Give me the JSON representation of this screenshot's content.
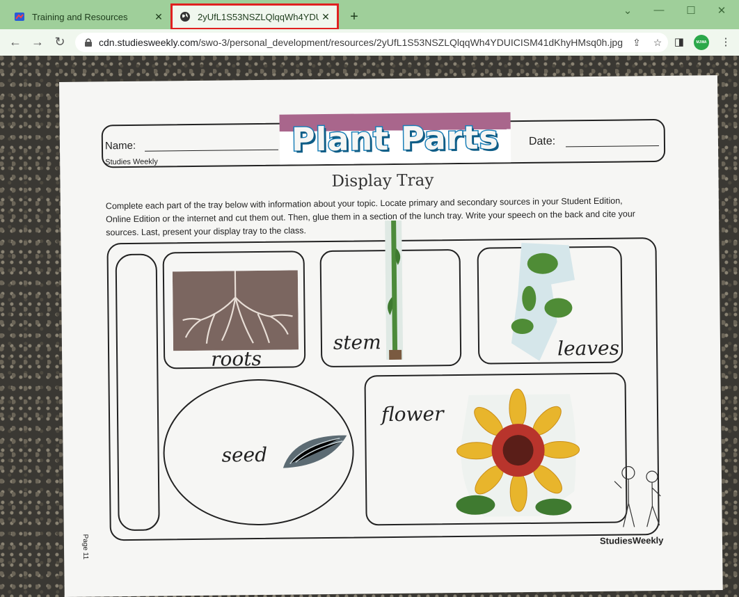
{
  "browser": {
    "tabs": [
      {
        "title": "Training and Resources",
        "active": false,
        "icon": "studiesweekly-favicon"
      },
      {
        "title": "2yUfL1S53NSZLQlqqWh4YDUICISM41dKhyHMsq0h.jpg",
        "active": true,
        "icon": "globe-icon"
      }
    ],
    "new_tab_symbol": "+",
    "url_host": "cdn.studiesweekly.com",
    "url_path": "/swo-3/personal_development/resources/2yUfL1S53NSZLQlqqWh4YDUICISM41dKhyHMsq0h.jpg",
    "profile_initials": "MJWA",
    "accent": "#9fcf9a"
  },
  "worksheet": {
    "name_label": "Name:",
    "brand_small": "Studies Weekly",
    "title": "Plant Parts",
    "date_label": "Date:",
    "subtitle": "Display Tray",
    "instructions": "Complete each part of the tray below with information about your topic. Locate primary and secondary sources in your Student Edition, Online Edition or the internet and cut them out. Then, glue them in a section of the lunch tray. Write your speech on the back and cite your sources. Last, present your display tray to the class.",
    "labels": {
      "roots": "roots",
      "stem": "stem",
      "leaves": "leaves",
      "seed": "seed",
      "flower": "flower"
    },
    "page": "Page 11",
    "footer_brand": "StudiesWeekly"
  }
}
